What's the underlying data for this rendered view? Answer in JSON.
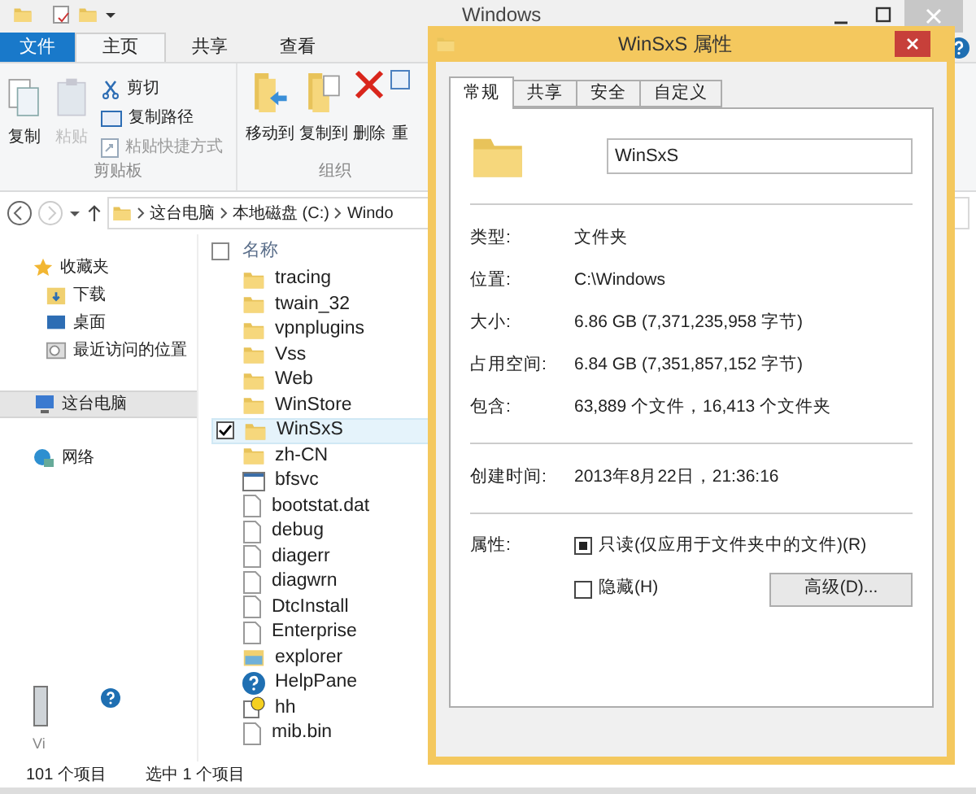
{
  "explorer": {
    "title": "Windows",
    "ribbon_tabs": [
      {
        "label": "文件",
        "kind": "file"
      },
      {
        "label": "主页",
        "kind": "tab",
        "selected": true
      },
      {
        "label": "共享",
        "kind": "tab",
        "selected": false
      },
      {
        "label": "查看",
        "kind": "tab",
        "selected": false
      }
    ],
    "clipboard": {
      "label": "剪贴板",
      "large": [
        {
          "label": "复制",
          "disabled": false,
          "kind": "copy"
        },
        {
          "label": "粘贴",
          "disabled": true,
          "kind": "paste"
        }
      ],
      "small": [
        {
          "label": "剪切",
          "disabled": false,
          "kind": "cut"
        },
        {
          "label": "复制路径",
          "disabled": false,
          "kind": "path"
        },
        {
          "label": "粘贴快捷方式",
          "disabled": true,
          "kind": "shortcut"
        }
      ]
    },
    "organize": {
      "label": "组织",
      "buttons": [
        {
          "label": "移动到",
          "kind": "move"
        },
        {
          "label": "复制到",
          "kind": "copyto"
        },
        {
          "label": "删除",
          "kind": "delete"
        },
        {
          "label": "重",
          "kind": "rename"
        }
      ]
    },
    "breadcrumb": [
      "这台电脑",
      "本地磁盘 (C:)",
      "Windo"
    ],
    "nav": [
      {
        "label": "收藏夹",
        "kind": "star",
        "selected": false,
        "children": [
          {
            "label": "下载",
            "kind": "download",
            "selected": false
          },
          {
            "label": "桌面",
            "kind": "desktop",
            "selected": false
          },
          {
            "label": "最近访问的位置",
            "kind": "recent",
            "selected": false
          }
        ]
      },
      {
        "label": "这台电脑",
        "kind": "pc",
        "selected": true
      },
      {
        "label": "网络",
        "kind": "network",
        "selected": false
      }
    ],
    "list_header": "名称",
    "select_all_checked": false,
    "files": [
      {
        "name": "tracing",
        "kind": "folder",
        "selected": false
      },
      {
        "name": "twain_32",
        "kind": "folder",
        "selected": false
      },
      {
        "name": "vpnplugins",
        "kind": "folder",
        "selected": false
      },
      {
        "name": "Vss",
        "kind": "folder",
        "selected": false
      },
      {
        "name": "Web",
        "kind": "folder",
        "selected": false
      },
      {
        "name": "WinStore",
        "kind": "folder",
        "selected": false
      },
      {
        "name": "WinSxS",
        "kind": "folder",
        "selected": true
      },
      {
        "name": "zh-CN",
        "kind": "folder",
        "selected": false
      },
      {
        "name": "bfsvc",
        "kind": "exe",
        "selected": false
      },
      {
        "name": "bootstat.dat",
        "kind": "file",
        "selected": false
      },
      {
        "name": "debug",
        "kind": "file",
        "selected": false
      },
      {
        "name": "diagerr",
        "kind": "file",
        "selected": false
      },
      {
        "name": "diagwrn",
        "kind": "file",
        "selected": false
      },
      {
        "name": "DtcInstall",
        "kind": "file",
        "selected": false
      },
      {
        "name": "Enterprise",
        "kind": "file",
        "selected": false
      },
      {
        "name": "explorer",
        "kind": "explorer",
        "selected": false
      },
      {
        "name": "HelpPane",
        "kind": "help",
        "selected": false
      },
      {
        "name": "hh",
        "kind": "hh",
        "selected": false
      },
      {
        "name": "mib.bin",
        "kind": "file",
        "selected": false
      }
    ],
    "preview_text": "Vi",
    "status": [
      "101 个项目",
      "选中 1 个项目"
    ]
  },
  "dialog": {
    "title": "WinSxS 属性",
    "tabs": [
      {
        "label": "常规",
        "selected": true
      },
      {
        "label": "共享",
        "selected": false
      },
      {
        "label": "安全",
        "selected": false
      },
      {
        "label": "自定义",
        "selected": false
      }
    ],
    "name_value": "WinSxS",
    "groups": [
      [
        {
          "label": "类型:",
          "value": "文件夹"
        },
        {
          "label": "位置:",
          "value": "C:\\Windows"
        },
        {
          "label": "大小:",
          "value": "6.86 GB (7,371,235,958 字节)"
        },
        {
          "label": "占用空间:",
          "value": "6.84 GB (7,351,857,152 字节)"
        },
        {
          "label": "包含:",
          "value": "63,889 个文件，16,413 个文件夹"
        }
      ],
      [
        {
          "label": "创建时间:",
          "value": "2013年8月22日，21:36:16"
        }
      ]
    ],
    "attributes_label": "属性:",
    "attributes": [
      {
        "label": "只读(仅应用于文件夹中的文件)(R)",
        "mixed": true
      },
      {
        "label": "隐藏(H)",
        "mixed": false
      }
    ],
    "advanced_button": "高级(D)..."
  }
}
